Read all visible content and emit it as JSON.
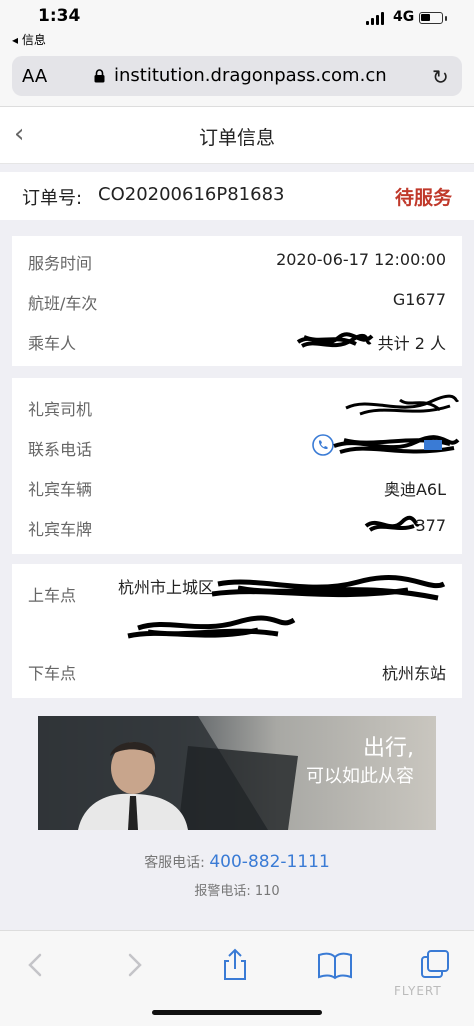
{
  "status": {
    "time": "1:34",
    "back_app": "◂ 信息",
    "network": "4G"
  },
  "browser": {
    "aa_label": "AA",
    "url": "institution.dragonpass.com.cn"
  },
  "nav": {
    "title": "订单信息"
  },
  "order": {
    "label": "订单号:",
    "number": "CO20200616P81683",
    "status": "待服务",
    "status_color": "#c0392b"
  },
  "trip": {
    "rows": [
      {
        "label": "服务时间",
        "value": "2020-06-17 12:00:00"
      },
      {
        "label": "航班/车次",
        "value": "G1677"
      },
      {
        "label": "乘车人",
        "value": "共计 2 人"
      }
    ]
  },
  "driver": {
    "rows": [
      {
        "label": "礼宾司机",
        "value": ""
      },
      {
        "label": "联系电话",
        "value": ""
      },
      {
        "label": "礼宾车辆",
        "value": "奥迪A6L"
      },
      {
        "label": "礼宾车牌",
        "value": "377"
      }
    ]
  },
  "address": {
    "pickup_label": "上车点",
    "pickup_value": "杭州市上城区",
    "dropoff_label": "下车点",
    "dropoff_value": "杭州东站"
  },
  "banner": {
    "line1": "出行,",
    "line2": "可以如此从容"
  },
  "contact": {
    "service_label": "客服电话:",
    "service_number": "400-882-1111",
    "alarm_label": "报警电话:",
    "alarm_number": "110"
  },
  "watermark": "FLYERT",
  "accent_color": "#3a7bd5"
}
